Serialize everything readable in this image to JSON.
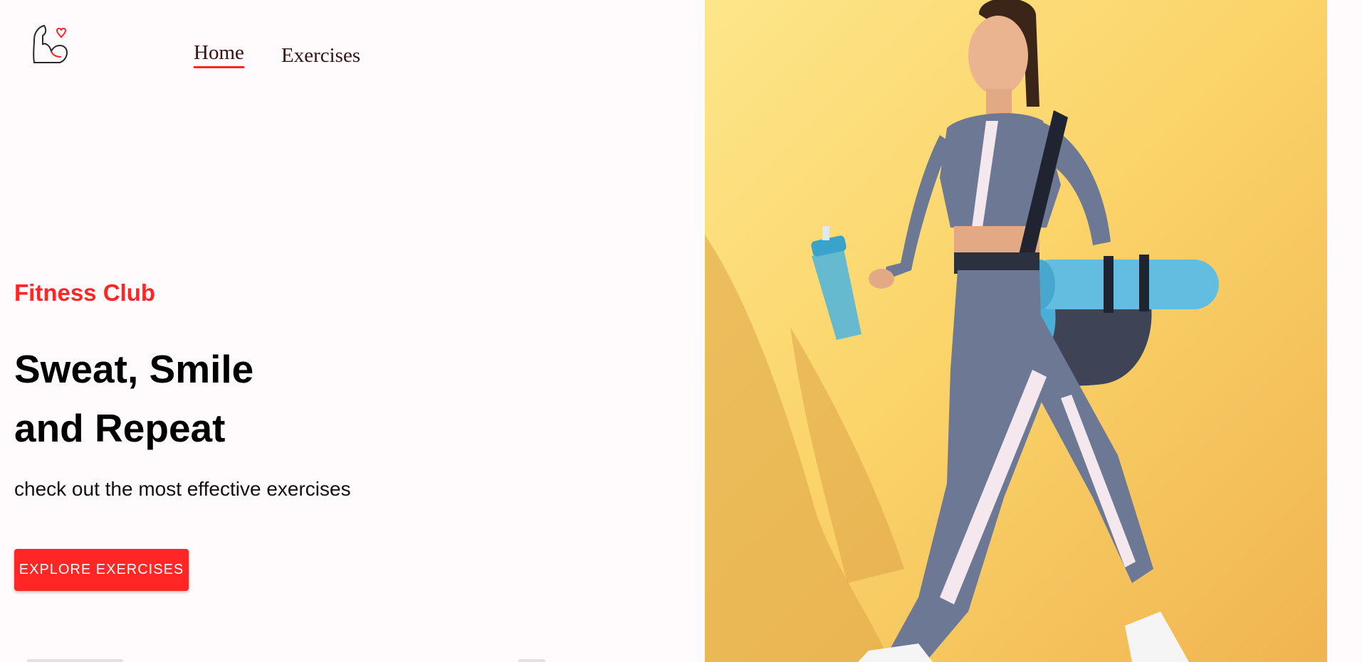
{
  "nav": {
    "logo_icon": "flexed-bicep-heart-icon",
    "links": [
      {
        "label": "Home",
        "active": true
      },
      {
        "label": "Exercises",
        "active": false
      }
    ]
  },
  "hero": {
    "eyebrow": "Fitness Club",
    "headline_line1": "Sweat, Smile",
    "headline_line2": "and Repeat",
    "subtitle": "check out the most effective exercises",
    "cta_label": "EXPLORE EXERCISES",
    "image_alt": "woman in sportswear carrying a gym bag, yoga mat and shaker bottle"
  },
  "colors": {
    "accent": "#ff2625",
    "background": "#fffafb",
    "image_background": "#fbd46a"
  }
}
